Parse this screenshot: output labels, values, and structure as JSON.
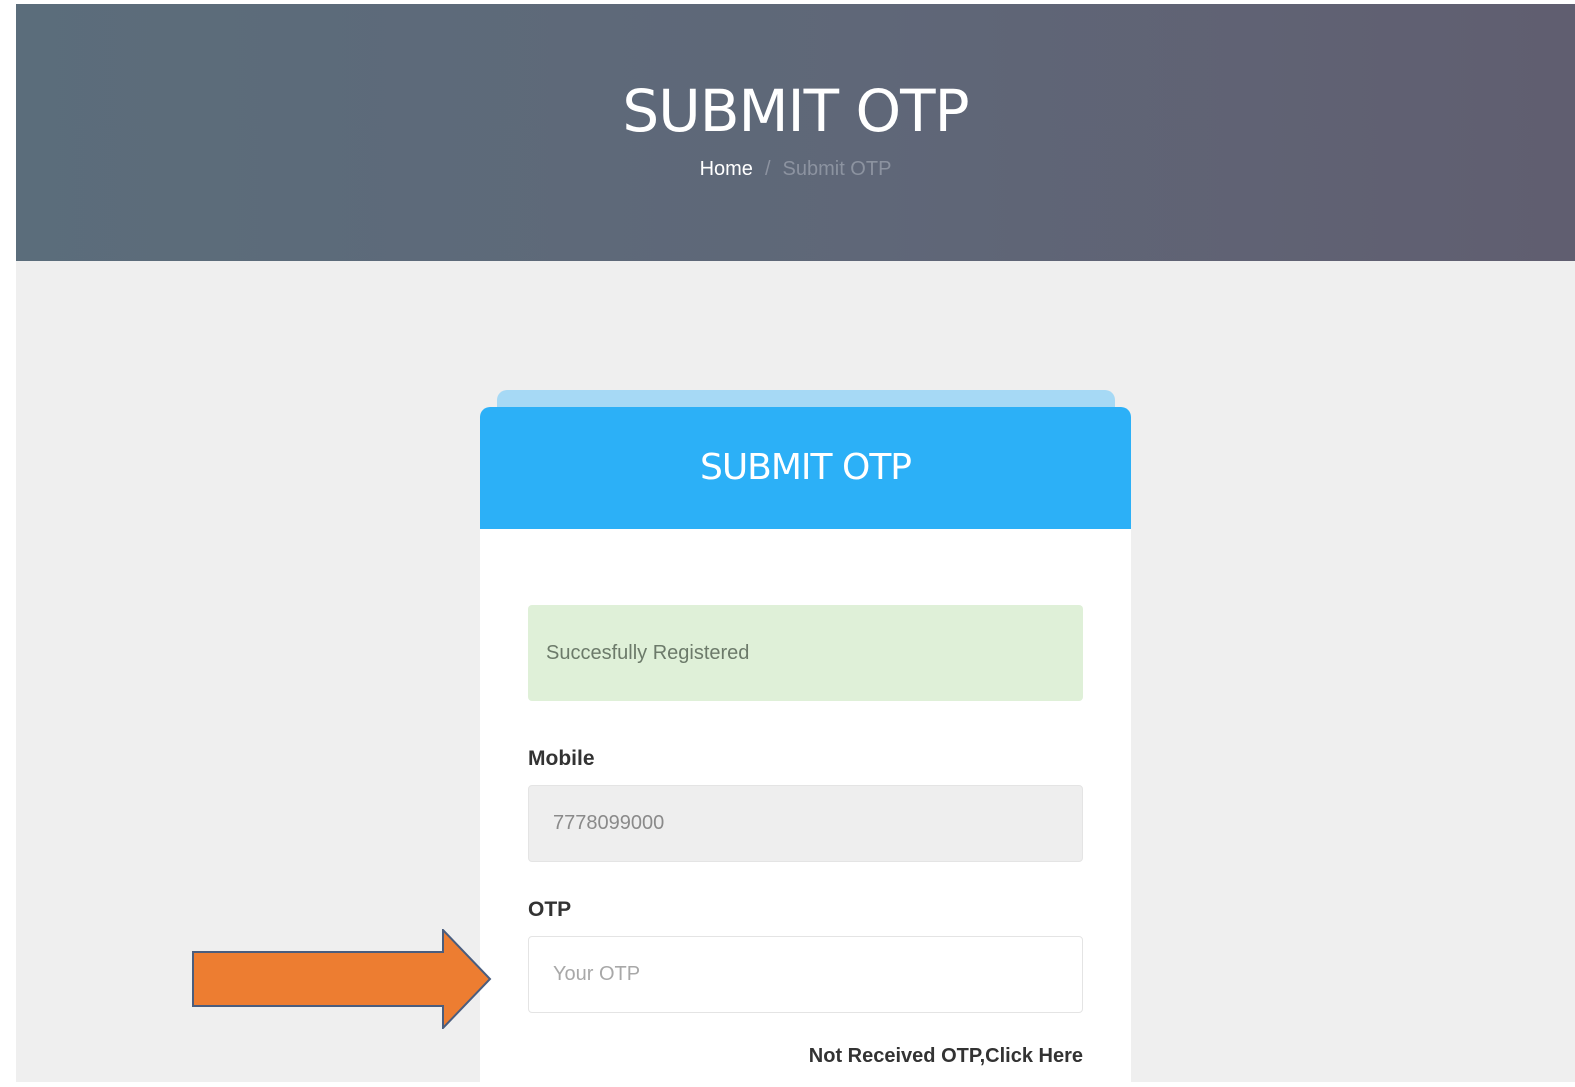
{
  "hero": {
    "title": "SUBMIT OTP",
    "breadcrumb": {
      "home": "Home",
      "separator": "/",
      "current": "Submit OTP"
    }
  },
  "card": {
    "title": "SUBMIT OTP",
    "alert": "Succesfully Registered",
    "mobile": {
      "label": "Mobile",
      "value": "7778099000"
    },
    "otp": {
      "label": "OTP",
      "placeholder": "Your OTP"
    },
    "resend_link": "Not Received OTP,Click Here"
  },
  "colors": {
    "header_bg_start": "#5b6d7b",
    "header_bg_end": "#605e70",
    "card_header": "#2cb0f7",
    "alert_success_bg": "#dff0d8",
    "arrow": "#ed7d31"
  },
  "annotation": {
    "arrow_icon": "right-arrow-icon"
  }
}
